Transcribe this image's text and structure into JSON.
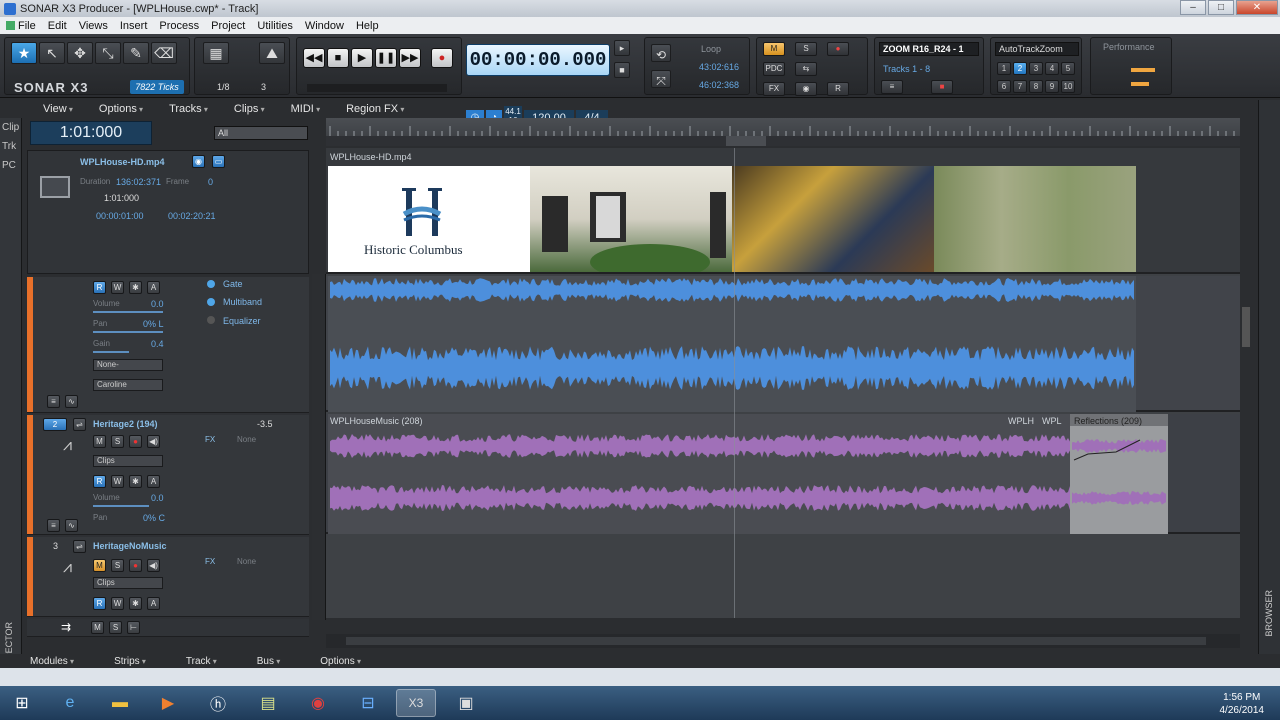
{
  "window": {
    "title": "SONAR X3 Producer - [WPLHouse.cwp* - Track]"
  },
  "menu": [
    "File",
    "Edit",
    "Views",
    "Insert",
    "Process",
    "Project",
    "Utilities",
    "Window",
    "Help"
  ],
  "controlbar": {
    "logo": "SONAR X3",
    "tool_labels": [
      "Smart",
      "Select",
      "Move",
      "Edit",
      "Draw",
      "Erase"
    ],
    "ticks": "7822 Ticks",
    "snap": "1/8",
    "snap_count": "3",
    "time": "00:00:00.000",
    "sample_rate": "44.1",
    "bit_depth": "16",
    "tempo": "120.00",
    "meter": "4/4",
    "loop_label": "Loop",
    "loop_start": "43:02:616",
    "loop_end": "46:02:368",
    "mix_buttons": [
      "M",
      "S",
      "PDC",
      "FX"
    ],
    "zoom_preset": "ZOOM R16_R24 - 1",
    "tracks_range": "Tracks 1 - 8",
    "autotrack": "AutoTrackZoom",
    "screensets_row1": [
      "1",
      "2",
      "3",
      "4",
      "5"
    ],
    "screensets_row2": [
      "6",
      "7",
      "8",
      "9",
      "10"
    ],
    "performance": "Performance"
  },
  "trackview_menu": [
    "View",
    "Options",
    "Tracks",
    "Clips",
    "MIDI",
    "Region FX"
  ],
  "left_tabs": [
    "Clip",
    "Trk",
    "PC"
  ],
  "inspector": {
    "now_time": "1:01:000",
    "filter": "All",
    "clip_name": "WPLHouse-HD.mp4",
    "duration_label": "Duration",
    "duration_value": "136:02:371",
    "frame_label": "Frame",
    "frame_value": "0",
    "start": "1:01:000",
    "time_start": "00:00:01:00",
    "time_end": "00:02:20:21"
  },
  "track1": {
    "fx": [
      "Gate",
      "Multiband",
      "Equalizer"
    ],
    "volume_label": "Volume",
    "volume_value": "0.0",
    "pan_label": "Pan",
    "pan_value": "0% L",
    "gain_label": "Gain",
    "gain_value": "0.4",
    "input": "None-",
    "output": "Caroline"
  },
  "track2": {
    "number": "2",
    "name": "Heritage2 (194)",
    "level": "-3.5",
    "view": "Clips",
    "volume_label": "Volume",
    "volume_value": "0.0",
    "pan_label": "Pan",
    "pan_value": "0% C",
    "fx_label": "FX",
    "none_label": "None"
  },
  "track3": {
    "number": "3",
    "name": "HeritageNoMusic",
    "view": "Clips",
    "fx_label": "FX",
    "none_label": "None"
  },
  "timeline": {
    "video_clip": "WPLHouse-HD.mp4",
    "thumb_title": "Historic Columbus",
    "audio2_clip": "WPLHouseMusic (208)",
    "audio2_tags": [
      "WPLH",
      "WPL"
    ],
    "reflections_clip": "Reflections (209)"
  },
  "bottom_tabs": [
    "Modules",
    "Strips",
    "Track",
    "Bus",
    "Options"
  ],
  "right_tab": "BROWSER",
  "left_bottom_tab": "SPECTOR",
  "taskbar": {
    "time": "1:56 PM",
    "date": "4/26/2014",
    "icons": [
      "start-orb",
      "ie",
      "explorer",
      "media",
      "hp",
      "notes",
      "chrome",
      "windows-app",
      "sonar",
      "other"
    ]
  }
}
